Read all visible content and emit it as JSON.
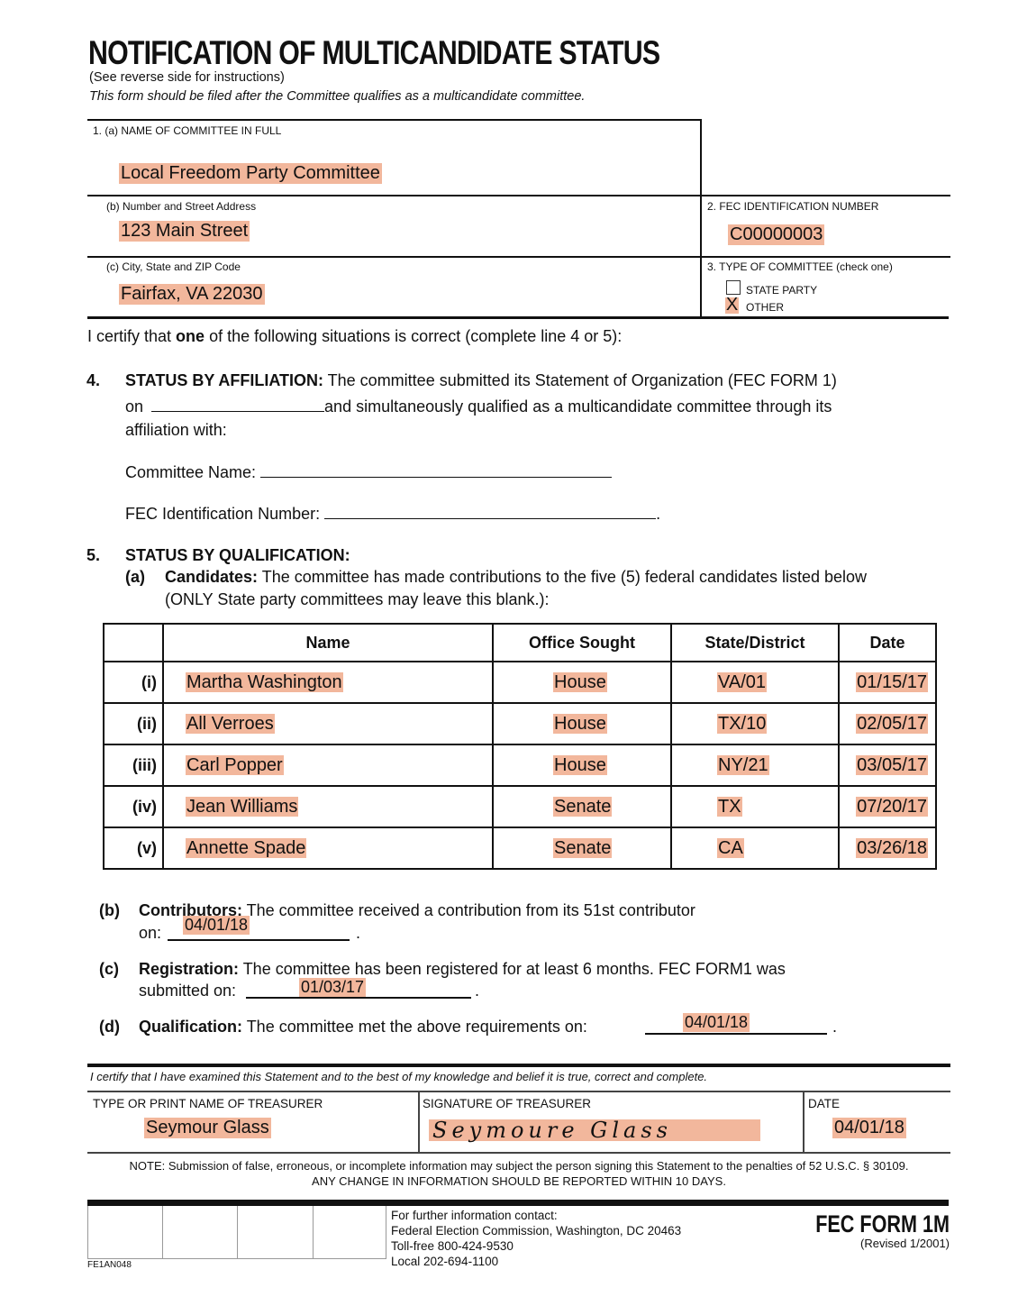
{
  "header": {
    "title": "NOTIFICATION OF MULTICANDIDATE STATUS",
    "subtitle": "(See reverse side for instructions)",
    "instruction": "This form should be filed after the Committee qualifies as a multicandidate committee."
  },
  "section1": {
    "name_label": "1.   (a) NAME OF COMMITTEE IN FULL",
    "name_value": "Local Freedom Party Committee",
    "street_label": "(b) Number and Street Address",
    "street_value": "123 Main Street",
    "city_label": "(c) City, State and ZIP Code",
    "city_value": "Fairfax, VA  22030"
  },
  "section2": {
    "label": "2.   FEC IDENTIFICATION NUMBER",
    "value": "C00000003"
  },
  "section3": {
    "label": "3.   TYPE OF COMMITTEE (check one)",
    "options": [
      {
        "label": "STATE PARTY",
        "checked": false,
        "mark": ""
      },
      {
        "label": "OTHER",
        "checked": true,
        "mark": "X"
      }
    ]
  },
  "certify_intro": {
    "before": "I certify that ",
    "bold": "one",
    "after": " of the following situations is correct (complete line 4 or 5):"
  },
  "section4": {
    "number": "4.",
    "heading": "STATUS BY AFFILIATION:",
    "text1": " The committee submitted its Statement of Organization (FEC FORM 1)",
    "on_label": "on",
    "on_value": "",
    "text2": "and simultaneously qualified as a multicandidate committee through its",
    "text3": "affiliation with:",
    "committee_name_label": "Committee Name:",
    "committee_name_value": "",
    "fec_id_label": "FEC Identification Number:",
    "fec_id_value": ""
  },
  "section5": {
    "number": "5.",
    "heading": "STATUS BY QUALIFICATION:",
    "a": {
      "letter": "(a)",
      "heading": "Candidates:",
      "text1": " The committee has made contributions to the five (5) federal candidates listed below",
      "text2": "(ONLY State party committees may leave this blank.):"
    },
    "table": {
      "headers": [
        "",
        "Name",
        "Office Sought",
        "State/District",
        "Date"
      ],
      "rows": [
        {
          "num": "(i)",
          "name": "Martha Washington",
          "office": "House",
          "state": "VA/01",
          "date": "01/15/17"
        },
        {
          "num": "(ii)",
          "name": "All Verroes",
          "office": "House",
          "state": "TX/10",
          "date": "02/05/17"
        },
        {
          "num": "(iii)",
          "name": "Carl Popper",
          "office": "House",
          "state": "NY/21",
          "date": "03/05/17"
        },
        {
          "num": "(iv)",
          "name": "Jean Williams",
          "office": "Senate",
          "state": "TX",
          "date": "07/20/17"
        },
        {
          "num": "(v)",
          "name": "Annette Spade",
          "office": "Senate",
          "state": "CA",
          "date": "03/26/18"
        }
      ]
    },
    "b": {
      "letter": "(b)",
      "heading": "Contributors:",
      "text1": " The committee received a contribution from its 51st contributor",
      "on_label": "on:",
      "value": "04/01/18",
      "end": "."
    },
    "c": {
      "letter": "(c)",
      "heading": "Registration:",
      "text1": " The committee has been registered for at least 6 months. FEC FORM1 was",
      "on_label": "submitted on:",
      "value": "01/03/17",
      "end": "."
    },
    "d": {
      "letter": "(d)",
      "heading": "Qualification:",
      "text1": " The committee met the above requirements on:",
      "value": "04/01/18",
      "end": "."
    }
  },
  "certification": {
    "statement": "I certify that I have examined this Statement and to the best of my knowledge and belief it is true, correct and complete.",
    "treasurer_name_label": "TYPE OR PRINT NAME OF TREASURER",
    "treasurer_name_value": "Seymour Glass",
    "signature_label": "SIGNATURE OF TREASURER",
    "signature_value": "Seymoure Glass",
    "date_label": "DATE",
    "date_value": "04/01/18"
  },
  "note": {
    "line1": "NOTE: Submission of false, erroneous, or incomplete information may subject the person signing this Statement to the penalties of 52 U.S.C. § 30109.",
    "line2": "ANY CHANGE IN INFORMATION SHOULD BE REPORTED WITHIN 10 DAYS."
  },
  "footer": {
    "code": "FE1AN048",
    "contact_lines": [
      "For further information contact:",
      "Federal Election Commission, Washington, DC 20463",
      "Toll-free 800-424-9530",
      "Local 202-694-1100"
    ],
    "form_name": "FEC FORM 1M",
    "revised": "(Revised 1/2001)"
  },
  "colors": {
    "highlight": "#f2b79c",
    "ink": "#111111"
  }
}
